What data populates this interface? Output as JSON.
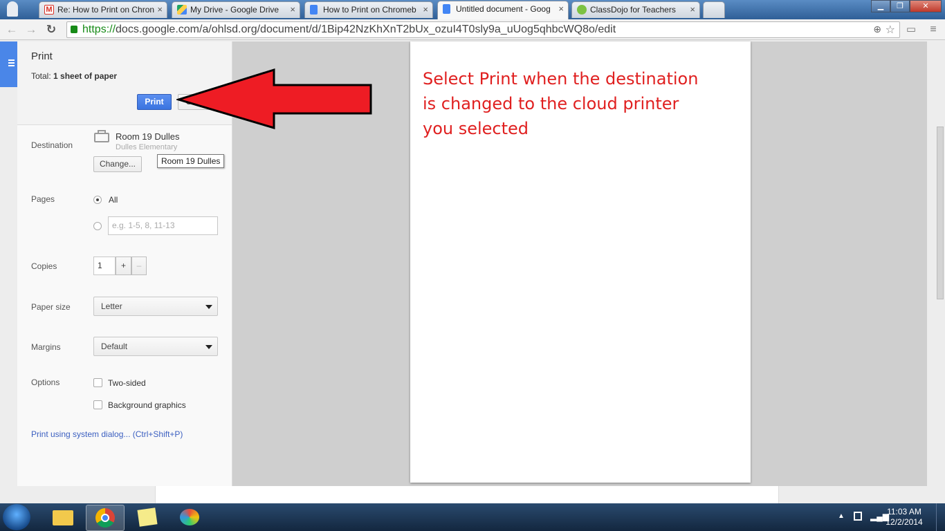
{
  "browser": {
    "tabs": [
      {
        "label": "Re: How to Print on Chron",
        "icon": "gmail-icon",
        "color": "#d93025"
      },
      {
        "label": "My Drive - Google Drive",
        "icon": "drive-icon",
        "color": "#1fa463"
      },
      {
        "label": "How to Print on Chromeb",
        "icon": "docs-icon",
        "color": "#4285f4"
      },
      {
        "label": "Untitled document - Goog",
        "icon": "docs-icon",
        "color": "#4285f4",
        "active": true
      },
      {
        "label": "ClassDojo for Teachers",
        "icon": "classdojo-icon",
        "color": "#7cc243"
      }
    ],
    "url_scheme": "https://",
    "url_rest": "docs.google.com/a/ohlsd.org/document/d/1Bip42NzKhXnT2bUx_ozuI4T0sly9a_uUog5qhbcWQ8o/edit"
  },
  "print": {
    "title": "Print",
    "total_label": "Total:",
    "total_value": "1 sheet of paper",
    "print_button": "Print",
    "cancel_button": "Cancel",
    "destination_label": "Destination",
    "destination_name": "Room 19 Dulles",
    "destination_sub": "Dulles Elementary",
    "change_button": "Change...",
    "tooltip": "Room 19 Dulles",
    "pages_label": "Pages",
    "pages_all": "All",
    "pages_placeholder": "e.g. 1-5, 8, 11-13",
    "copies_label": "Copies",
    "copies_value": "1",
    "copies_plus": "+",
    "copies_minus": "–",
    "paper_label": "Paper size",
    "paper_value": "Letter",
    "margins_label": "Margins",
    "margins_value": "Default",
    "options_label": "Options",
    "two_sided": "Two-sided",
    "background": "Background graphics",
    "system_dialog": "Print using system dialog... (Ctrl+Shift+P)"
  },
  "preview": {
    "annotation": "Select Print when the destination is changed to the cloud printer you selected"
  },
  "taskbar": {
    "time": "11:03 AM",
    "date": "12/2/2014"
  },
  "colors": {
    "accent": "#4a86e8",
    "annotation": "#e02020",
    "arrow": "#ee1c24"
  }
}
